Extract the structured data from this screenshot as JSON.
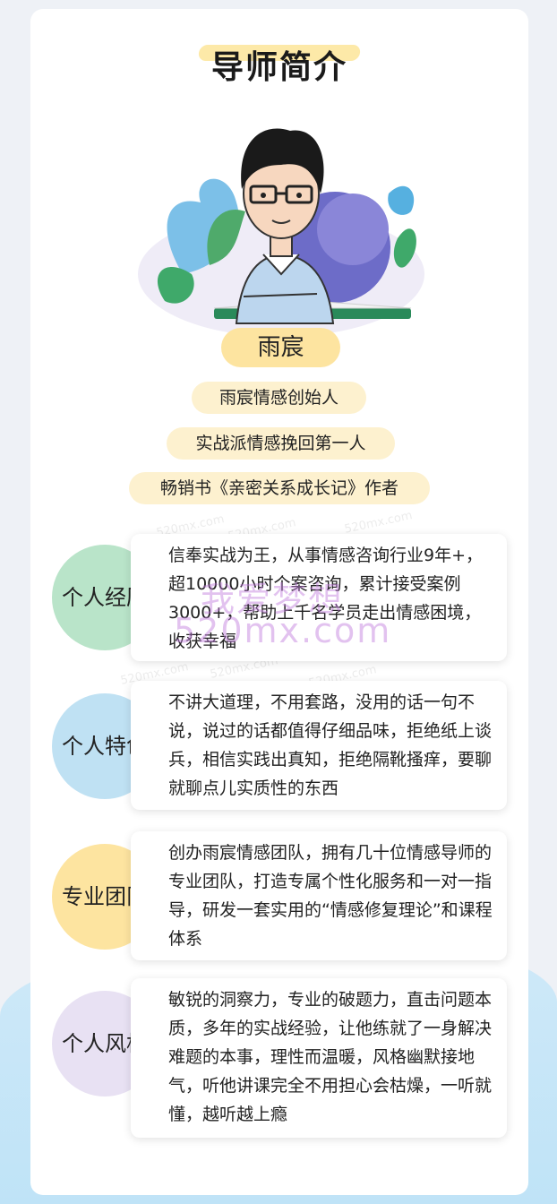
{
  "title": "导师简介",
  "name": "雨宸",
  "tags": [
    "雨宸情感创始人",
    "实战派情感挽回第一人",
    "畅销书《亲密关系成长记》作者"
  ],
  "sections": [
    {
      "label": "个人经历",
      "color": "#b9e4c9",
      "text": "信奉实战为王，从事情感咨询行业9年+，超10000小时个案咨询，累计接受案例3000+，帮助上千名学员走出情感困境，收获幸福"
    },
    {
      "label": "个人特色",
      "color": "#bfe1f3",
      "text": "不讲大道理，不用套路，没用的话一句不说，说过的话都值得仔细品味，拒绝纸上谈兵，相信实践出真知，拒绝隔靴搔痒，要聊就聊点儿实质性的东西"
    },
    {
      "label": "专业团队",
      "color": "#fde4a0",
      "text": "创办雨宸情感团队，拥有几十位情感导师的专业团队，打造专属个性化服务和一对一指导，研发一套实用的“情感修复理论”和课程体系"
    },
    {
      "label": "个人风格",
      "color": "#e8e1f3",
      "text": "敏锐的洞察力，专业的破题力，直击问题本质，多年的实战经验，让他练就了一身解决难题的本事，理性而温暖，风格幽默接地气，听他讲课完全不用担心会枯燥，一听就懂，越听越上瘾"
    }
  ],
  "watermark": {
    "small": "520mx.com",
    "cn": "我爱梦想",
    "big": "520mx.com"
  }
}
